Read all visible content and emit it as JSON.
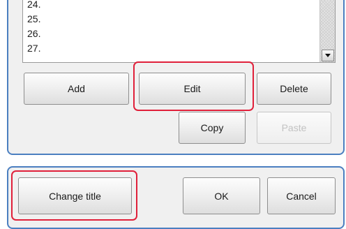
{
  "list": {
    "items": [
      "24.",
      "25.",
      "26.",
      "27."
    ]
  },
  "buttons": {
    "add": "Add",
    "edit": "Edit",
    "delete": "Delete",
    "copy": "Copy",
    "paste": "Paste",
    "change_title": "Change title",
    "ok": "OK",
    "cancel": "Cancel"
  },
  "colors": {
    "frame": "#4b7fc0",
    "highlight": "#e0203a",
    "panel_bg": "#f0f0f0"
  }
}
